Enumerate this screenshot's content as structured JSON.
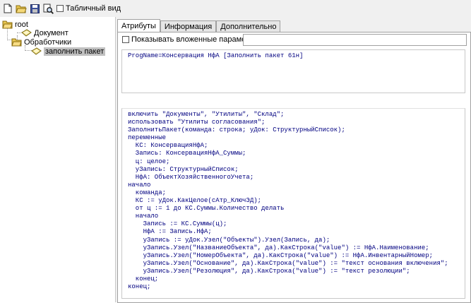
{
  "toolbar": {
    "buttons": [
      "new-file-icon",
      "open-folder-icon",
      "save-icon",
      "search-icon"
    ],
    "table_view_label": "Табличный вид",
    "table_view_checked": false
  },
  "tree": {
    "root": "root",
    "documents": "Документ",
    "handlers": "Обработчики",
    "fill_package": "заполнить пакет"
  },
  "tabs": [
    "Атрибуты",
    "Информация",
    "Дополнительно"
  ],
  "attributes": {
    "show_nested_label": "Показывать вложенные параметры:",
    "show_nested_checked": false,
    "filter_value": ""
  },
  "progname": {
    "text": "ProgName=Консервация НфА [Заполнить пакет 61н]"
  },
  "code_lines": [
    "включить \"Документы\", \"Утилиты\", \"Склад\";",
    "использовать \"Утилиты согласования\";",
    "ЗаполнитьПакет(команда: строка; уДок: СтруктурныйСписок);",
    "переменные",
    "  КС: КонсервацияНфА;",
    "  Запись: КонсервацияНфА_Суммы;",
    "  ц: целое;",
    "  уЗапись: СтруктурныйСписок;",
    "  НфА: ОбъектХозяйственногоУчета;",
    "начало",
    "  команда;",
    "  КС := уДок.КакЦелое(сАтр_КлючЭД);",
    "  от ц := 1 до КС.Суммы.Количество делать",
    "  начало",
    "    Запись := КС.Суммы(ц);",
    "    НфА := Запись.НфА;",
    "    уЗапись := уДок.Узел(\"Объекты\").Узел(Запись, да);",
    "    уЗапись.Узел(\"НазваниеОбъекта\", да).КакСтрока(\"value\") := НфА.Наименование;",
    "    уЗапись.Узел(\"НомерОбъекта\", да).КакСтрока(\"value\") := НфА.ИнвентарныйНомер;",
    "    уЗапись.Узел(\"Основание\", да).КакСтрока(\"value\") := \"текст основания включения\";",
    "    уЗапись.Узел(\"Резолюция\", да).КакСтрока(\"value\") := \"текст резолюции\";",
    "  конец;",
    "конец;"
  ]
}
